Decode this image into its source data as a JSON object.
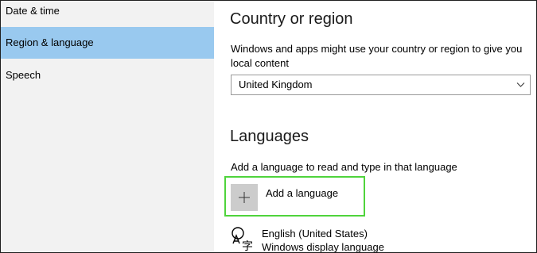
{
  "sidebar": {
    "items": [
      {
        "label": "Date & time"
      },
      {
        "label": "Region & language"
      },
      {
        "label": "Speech"
      }
    ]
  },
  "country": {
    "title": "Country or region",
    "description": "Windows and apps might use your country or region to give you local content",
    "selected": "United Kingdom"
  },
  "languages": {
    "title": "Languages",
    "description": "Add a language to read and type in that language",
    "add_label": "Add a language",
    "items": [
      {
        "name": "English (United States)",
        "subtitle": "Windows display language"
      }
    ]
  },
  "colors": {
    "selected_nav": "#99c9ef",
    "highlight_border": "#4fd43c",
    "sidebar_bg": "#f2f2f2"
  }
}
